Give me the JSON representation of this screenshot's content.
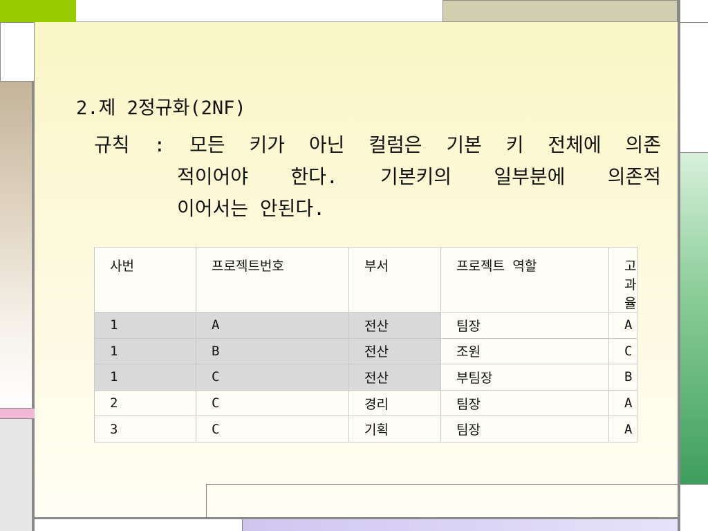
{
  "slide": {
    "title": "2.제 2정규화(2NF)",
    "rule_line1": "규칙 : 모든 키가 아닌 컬럼은 기본 키 전체에 의존",
    "rule_line2": "적이어야 한다. 기본키의 일부분에 의존적",
    "rule_line3": "이어서는 안된다."
  },
  "table": {
    "headers": [
      "사번",
      "프로젝트번호",
      "부서",
      "프로젝트 역할",
      "고과율"
    ],
    "rows": [
      [
        "1",
        "A",
        "전산",
        "팀장",
        "A"
      ],
      [
        "1",
        "B",
        "전산",
        "조원",
        "C"
      ],
      [
        "1",
        "C",
        "전산",
        "부팀장",
        "B"
      ],
      [
        "2",
        "C",
        "경리",
        "팀장",
        "A"
      ],
      [
        "3",
        "C",
        "기획",
        "팀장",
        "A"
      ]
    ],
    "highlight_color": "#d9d9d9"
  },
  "colors": {
    "accent_green": "#99cc00",
    "tan": "#c3b49a",
    "olive_gray": "#d7d6bb",
    "pink": "#f2b8d6",
    "lavender": "#d9d2f2",
    "green_bar": "#3e9e5e"
  }
}
